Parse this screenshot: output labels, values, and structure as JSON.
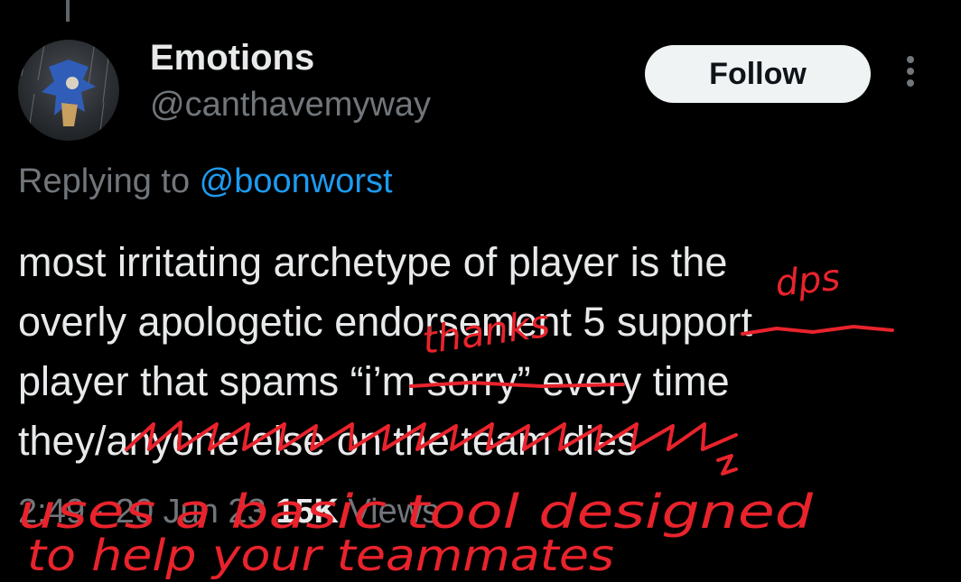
{
  "user": {
    "display_name": "Emotions",
    "handle": "@canthavemyway",
    "follow_label": "Follow"
  },
  "reply": {
    "prefix": "Replying to ",
    "mention": "@boonworst"
  },
  "tweet": {
    "lines": [
      "most irritating archetype of player is the",
      "overly apologetic endorsement 5 support",
      "player that spams “i’m sorry” every time",
      "they/anyone else on the team dies"
    ]
  },
  "meta": {
    "time": "2:49",
    "separator": " · ",
    "date": "20 Jun 23",
    "views_count": "15K",
    "views_label": " Views"
  },
  "annotations": {
    "color": "#e8232c",
    "word_thanks": "thanks",
    "word_dps": "dps",
    "line_1": "uses a basic tool designed",
    "line_2": "to help your teammates"
  },
  "icons": {
    "more": "more-vertical-icon",
    "avatar": "profile-picture"
  }
}
